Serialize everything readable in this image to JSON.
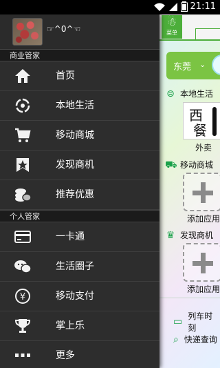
{
  "status_bar": {
    "time": "21:11"
  },
  "drawer": {
    "profile": {
      "nickname": "☞^0^☜"
    },
    "groups": [
      {
        "title": "商业管家",
        "items": [
          {
            "label": "首页",
            "icon": "home-icon"
          },
          {
            "label": "本地生活",
            "icon": "local-life-icon"
          },
          {
            "label": "移动商城",
            "icon": "cart-icon"
          },
          {
            "label": "发现商机",
            "icon": "discover-icon"
          },
          {
            "label": "推荐优惠",
            "icon": "coins-icon"
          }
        ]
      },
      {
        "title": "个人管家",
        "items": [
          {
            "label": "一卡通",
            "icon": "card-icon"
          },
          {
            "label": "生活圈子",
            "icon": "chat-icon"
          },
          {
            "label": "移动支付",
            "icon": "yuan-icon"
          },
          {
            "label": "掌上乐",
            "icon": "trophy-icon"
          },
          {
            "label": "更多",
            "icon": "more-icon"
          }
        ]
      }
    ]
  },
  "background_app": {
    "menu_label": "菜单",
    "city": "东莞",
    "sections": {
      "local_life": "本地生活",
      "mall": "移动商城",
      "discover": "发现商机"
    },
    "food_tile": {
      "line1": "西",
      "line2": "餐",
      "caption": "外卖"
    },
    "add_app": "添加应用",
    "rows": {
      "train": "列车时刻",
      "express": "快递查询"
    }
  },
  "colors": {
    "accent_green": "#4cae3a",
    "drawer_bg": "#2d2d2d"
  }
}
